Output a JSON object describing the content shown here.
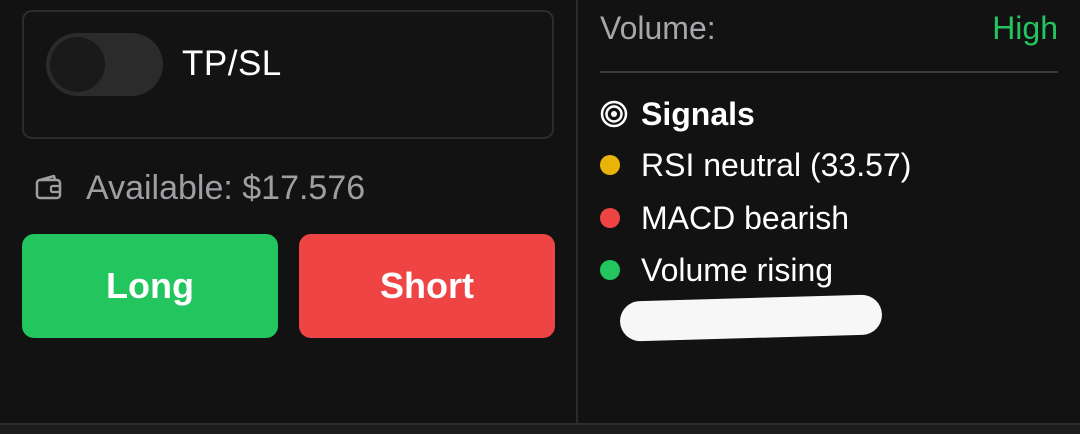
{
  "trade_panel": {
    "tpsl_toggle": {
      "label": "TP/SL",
      "enabled": false
    },
    "available": {
      "icon": "wallet-icon",
      "text": "Available: $17.576"
    },
    "long_button": {
      "label": "Long",
      "color": "#22c55e"
    },
    "short_button": {
      "label": "Short",
      "color": "#ef4444"
    }
  },
  "analysis_panel": {
    "volume": {
      "label": "Volume:",
      "value": "High",
      "value_color": "#22c55e"
    },
    "signals": {
      "icon": "target-icon",
      "title": "Signals",
      "items": [
        {
          "text": "RSI neutral (33.57)",
          "status": "neutral",
          "color": "#eab308"
        },
        {
          "text": "MACD bearish",
          "status": "bearish",
          "color": "#ef4444"
        },
        {
          "text": "Volume rising",
          "status": "bullish",
          "color": "#22c55e"
        }
      ]
    }
  }
}
